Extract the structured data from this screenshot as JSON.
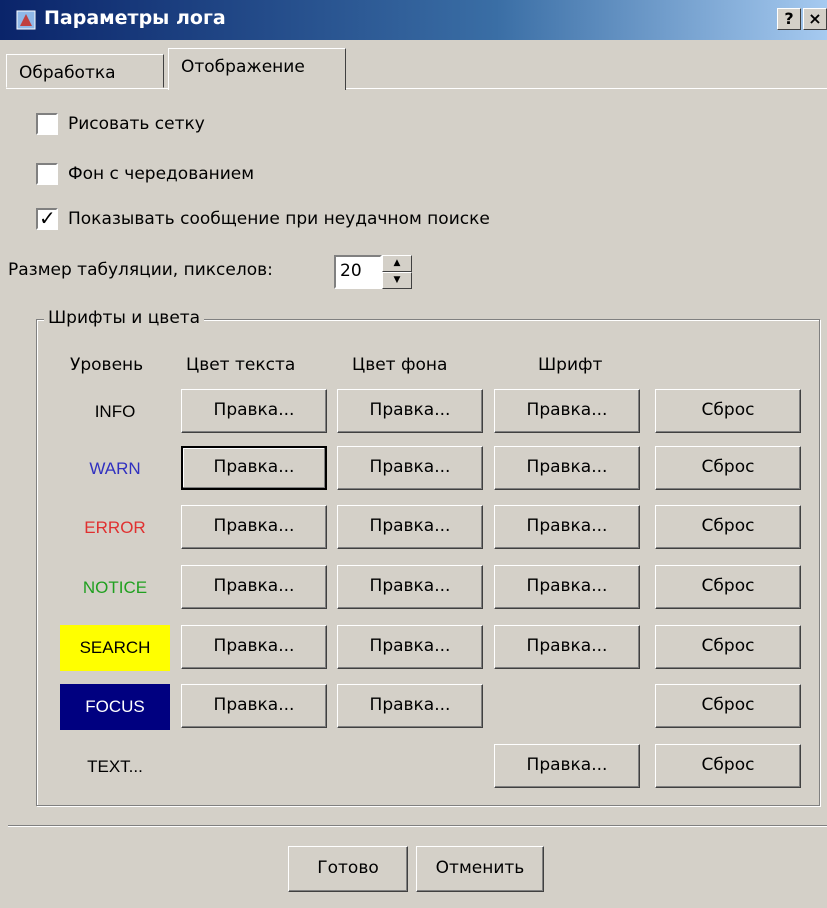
{
  "window": {
    "title": "Параметры лога",
    "help_label": "?",
    "close_label": "×"
  },
  "tabs": [
    {
      "label": "Обработка"
    },
    {
      "label": "Отображение"
    }
  ],
  "checkboxes": [
    {
      "label": "Рисовать сетку",
      "checked": false
    },
    {
      "label": "Фон с чередованием",
      "checked": false
    },
    {
      "label": "Показывать сообщение при неудачном поиске",
      "checked": true
    }
  ],
  "check_mark": "✓",
  "tab_size": {
    "label": "Размер табуляции, пикселов:",
    "value": "20"
  },
  "group": {
    "legend": "Шрифты и цвета",
    "headers": {
      "level": "Уровень",
      "text_color": "Цвет текста",
      "bg_color": "Цвет фона",
      "font": "Шрифт"
    },
    "edit_label": "Правка...",
    "reset_label": "Сброс",
    "rows": [
      {
        "level": "INFO",
        "color": "#000000",
        "bg": ""
      },
      {
        "level": "WARN",
        "color": "#3030c0",
        "bg": ""
      },
      {
        "level": "ERROR",
        "color": "#e03030",
        "bg": ""
      },
      {
        "level": "NOTICE",
        "color": "#20a020",
        "bg": ""
      },
      {
        "level": "SEARCH",
        "color": "#000000",
        "bg": "#ffff00"
      },
      {
        "level": "FOCUS",
        "color": "#ffffff",
        "bg": "#000080"
      },
      {
        "level": "TEXT...",
        "color": "#000000",
        "bg": ""
      }
    ]
  },
  "footer": {
    "ok_label": "Готово",
    "cancel_label": "Отменить"
  }
}
